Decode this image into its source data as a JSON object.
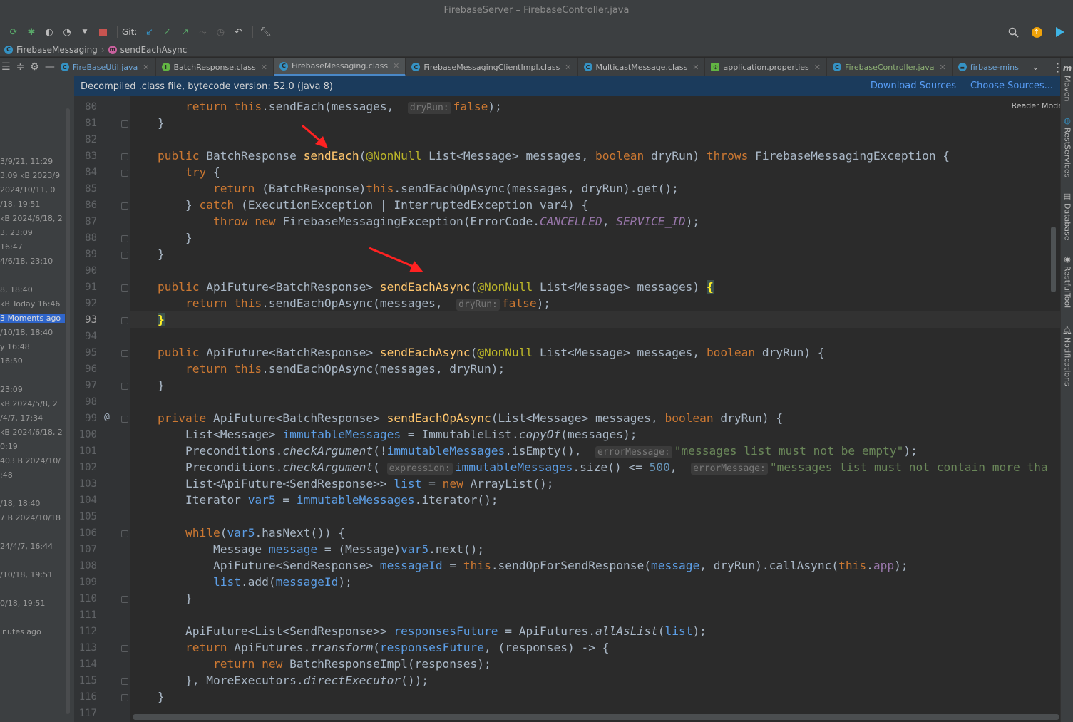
{
  "window": {
    "title": "FirebaseServer – FirebaseController.java"
  },
  "toolbar": {
    "git_label": "Git:"
  },
  "breadcrumb": {
    "items": [
      "FirebaseMessaging",
      "sendEachAsync"
    ]
  },
  "tabs": [
    {
      "label": "FireBaseUtil.java",
      "icon": "class-icon",
      "active": false
    },
    {
      "label": "BatchResponse.class",
      "icon": "interface-icon",
      "active": false
    },
    {
      "label": "FirebaseMessaging.class",
      "icon": "class-icon",
      "active": true
    },
    {
      "label": "FirebaseMessagingClientImpl.class",
      "icon": "class-icon",
      "active": false
    },
    {
      "label": "MulticastMessage.class",
      "icon": "class-icon",
      "active": false
    },
    {
      "label": "application.properties",
      "icon": "properties-icon",
      "active": false
    },
    {
      "label": "FirebaseController.java",
      "icon": "class-icon",
      "active": false
    },
    {
      "label": "firbase-mins",
      "icon": "file-icon",
      "active": false
    }
  ],
  "banner": {
    "text": "Decompiled .class file, bytecode version: 52.0 (Java 8)",
    "download_sources": "Download Sources",
    "choose_sources": "Choose Sources..."
  },
  "editor": {
    "reader_mode": "Reader Mode",
    "current_line": 93
  },
  "left_panel": {
    "items": [
      "3/9/21, 11:29",
      "3.09 kB 2023/9",
      "2024/10/11, 0",
      "/18, 19:51",
      "kB 2024/6/18, 2",
      "3, 23:09",
      "16:47",
      "4/6/18, 23:10",
      "8, 18:40",
      "kB Today 16:46",
      "3 Moments ago",
      "/10/18, 18:40",
      "y 16:48",
      "16:50",
      "23:09",
      "kB 2024/5/8, 2",
      "/4/7, 17:34",
      "kB 2024/6/18, 2",
      "0:19",
      "403 B 2024/10/",
      ":48",
      "/18, 18:40",
      "7 B 2024/10/18",
      "24/4/7, 16:44",
      "/10/18, 19:51",
      "0/18, 19:51",
      "inutes ago"
    ]
  },
  "right_bar": {
    "items": [
      "Maven",
      "RestServices",
      "Database",
      "RestfulTool",
      "Notifications"
    ]
  },
  "colors": {
    "banner_bg": "#1b3b5c",
    "link": "#589df6",
    "selection": "#2f65ca",
    "annotation_arrow": "#ff2222"
  }
}
